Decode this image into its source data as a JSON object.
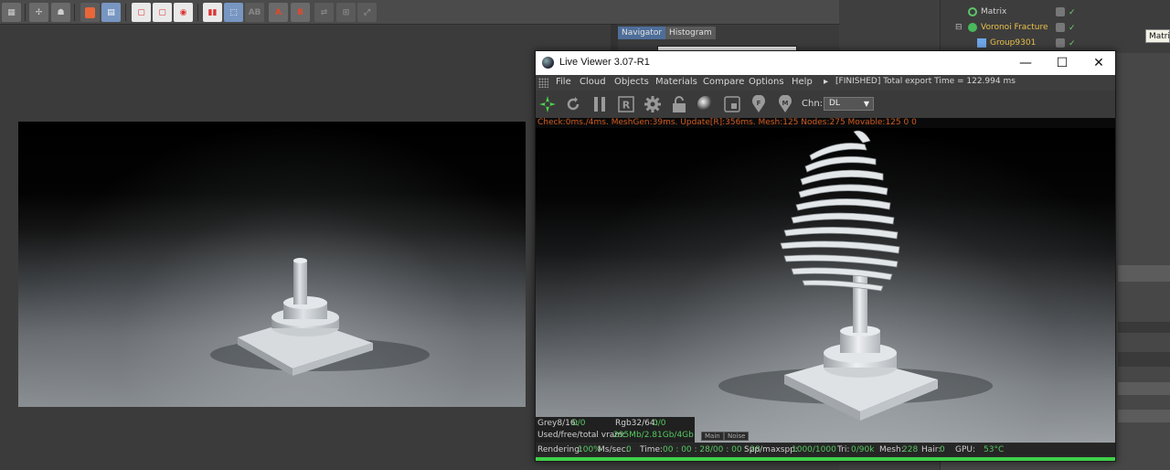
{
  "c4d": {
    "navigator_tabs": [
      "Navigator",
      "Histogram"
    ],
    "objects": [
      {
        "name": "Matrix",
        "color": "#d0d0d0"
      },
      {
        "name": "Voronoi Fracture",
        "color": "#e8c04a"
      },
      {
        "name": "Group9301",
        "color": "#e8c04a"
      }
    ],
    "tooltip": "Matrix"
  },
  "live_viewer": {
    "title": "Live Viewer 3.07-R1",
    "menu": [
      "File",
      "Cloud",
      "Objects",
      "Materials",
      "Compare",
      "Options",
      "Help"
    ],
    "menu_status": "[FINISHED] Total export Time = 122.994 ms",
    "channel_label": "Chn:",
    "channel_value": "DL",
    "stats": "Check:0ms./4ms. MeshGen:39ms. Update[R]:356ms. Mesh:125 Nodes:275 Movable:125  0 0",
    "info": {
      "grey_label": "Grey8/16:",
      "grey_value": "0/0",
      "rgb_label": "Rgb32/64:",
      "rgb_value": "0/0",
      "vram_label": "Used/free/total vram:",
      "vram_value": "295Mb/2.81Gb/4Gb"
    },
    "mini_tabs": [
      "Main",
      "Noise"
    ],
    "status": {
      "rendering_label": "Rendering:",
      "rendering_value": "100%",
      "mssec_label": "Ms/sec:",
      "mssec_value": "0",
      "time_label": "Time:",
      "time_value": "00 : 00 : 28/00 : 00 : 28",
      "spp_label": "Spp/maxspp:",
      "spp_value": "1000/1000",
      "tri_label": "Tri:",
      "tri_value": "0/90k",
      "mesh_label": "Mesh:",
      "mesh_value": "228",
      "hair_label": "Hair:",
      "hair_value": "0",
      "gpu_label": "GPU:",
      "gpu_value": "53°C"
    },
    "progress": 1.0
  }
}
